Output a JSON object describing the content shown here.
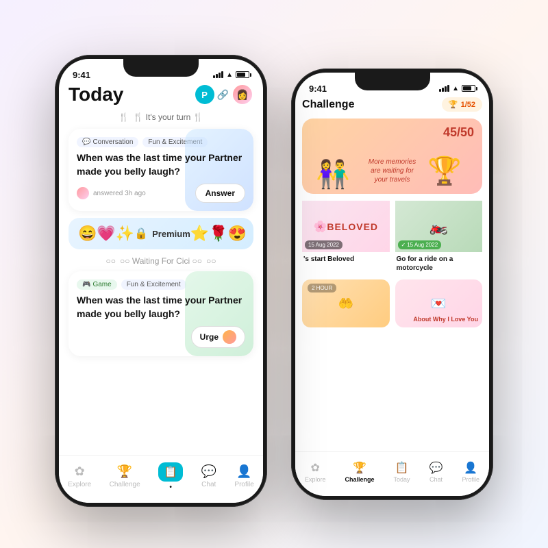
{
  "phones": {
    "phone1": {
      "status": {
        "time": "9:41",
        "signal": true,
        "wifi": true,
        "battery": true
      },
      "header": {
        "title": "Today",
        "partner_initial": "P",
        "avatar_emoji": "👩"
      },
      "turn_label": "🍴 It's your turn 🍴",
      "card1": {
        "tags": [
          "Conversation",
          "Fun & Excitement"
        ],
        "question": "When was the last time your Partner made you belly laugh?",
        "answered": "answered 3h ago",
        "answer_btn": "Answer"
      },
      "premium": {
        "label": "Premium",
        "emojis": [
          "😄",
          "💗",
          "✨",
          "🌹",
          "😍",
          "⭐"
        ]
      },
      "waiting_label": "○○ Waiting For Cici ○○",
      "card2": {
        "tags": [
          "Game",
          "Fun & Excitement"
        ],
        "question": "When was the last time your Partner made you belly laugh?",
        "urge_btn": "Urge"
      },
      "nav": {
        "items": [
          {
            "label": "Explore",
            "icon": "✿",
            "active": false
          },
          {
            "label": "Challenge",
            "icon": "🏆",
            "active": false
          },
          {
            "label": "",
            "icon": "📋",
            "active": true
          },
          {
            "label": "Chat",
            "icon": "💬",
            "active": false
          },
          {
            "label": "Profile",
            "icon": "👤",
            "active": false
          }
        ]
      }
    },
    "phone2": {
      "status": {
        "time": "9:41",
        "signal": true,
        "wifi": true,
        "battery": true
      },
      "header": {
        "title": "hallenge",
        "trophy_count": "1/52"
      },
      "hero": {
        "count": "45/50",
        "note": "More memories\nare waiting for\nyour travels",
        "trophy": "🏆",
        "couple": "👫"
      },
      "grid": {
        "card1": {
          "label": "'s start Beloved",
          "date": "15 Aug 2022"
        },
        "card2": {
          "label": "Go for a ride on a motorcycle",
          "date": "15 Aug 2022",
          "checked": true
        }
      },
      "small_grid": {
        "card1": {
          "hours": "2 HOUR",
          "emoji": "🤝"
        },
        "card2": {
          "title": "About Why I Love You",
          "emoji": "💌"
        }
      },
      "nav": {
        "items": [
          {
            "label": "Explore",
            "icon": "✿",
            "active": false
          },
          {
            "label": "Challenge",
            "icon": "🏆",
            "active": true
          },
          {
            "label": "Today",
            "icon": "📋",
            "active": false
          },
          {
            "label": "Chat",
            "icon": "💬",
            "active": false
          },
          {
            "label": "Profile",
            "icon": "👤",
            "active": false
          }
        ]
      }
    }
  }
}
